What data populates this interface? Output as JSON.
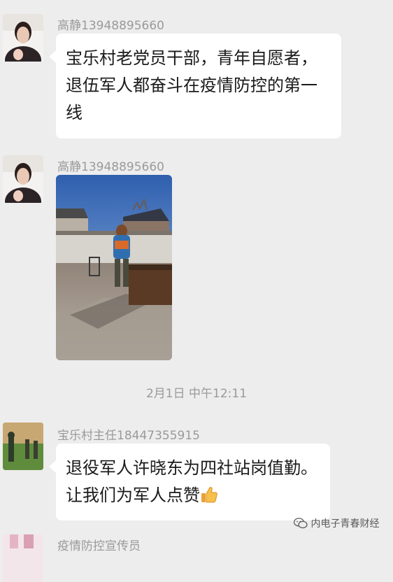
{
  "messages": [
    {
      "sender": "高静13948895660",
      "lines": [
        "宝乐村老党员干部，青年自愿者，",
        "退伍军人都奋斗在疫情防控的第一",
        "线"
      ]
    },
    {
      "sender": "高静13948895660",
      "type": "image"
    },
    {
      "sender": "宝乐村主任18447355915",
      "lines": [
        "退役军人许晓东为四社站岗值勤。",
        "让我们为军人点赞"
      ],
      "emoji": "thumbs-up-icon"
    },
    {
      "sender": "疫情防控宣传员"
    }
  ],
  "timestamp": "2月1日 中午12:11",
  "watermark": "内电子青春财经",
  "colors": {
    "background": "#ededed",
    "bubble": "#ffffff",
    "meta_text": "#9a9a9a"
  }
}
